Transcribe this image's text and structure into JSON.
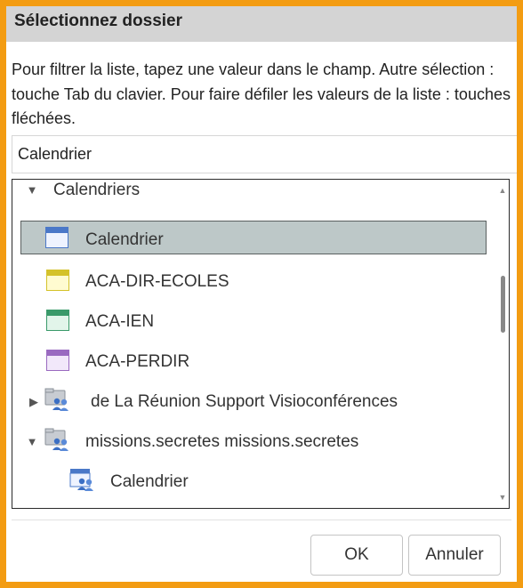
{
  "dialog": {
    "title": "Sélectionnez dossier",
    "instructions": "Pour filtrer la liste, tapez une valeur dans le champ. Autre sélection : touche Tab du clavier. Pour faire défiler les valeurs de la liste : touches fléchées."
  },
  "search": {
    "value": "Calendrier"
  },
  "tree": {
    "items": [
      {
        "label": "Calendriers",
        "icon": "expanded-arrow-icon",
        "expanded": true
      },
      {
        "label": "Calendrier",
        "icon": "calendar-blue-icon",
        "selected": true
      },
      {
        "label": "ACA-DIR-ECOLES",
        "icon": "calendar-yellow-icon"
      },
      {
        "label": "ACA-IEN",
        "icon": "calendar-green-icon"
      },
      {
        "label": "ACA-PERDIR",
        "icon": "calendar-purple-icon"
      },
      {
        "label": "de La Réunion Support Visioconférences",
        "icon": "shared-folder-icon",
        "expanded": false
      },
      {
        "label": "missions.secretes missions.secretes",
        "icon": "shared-folder-icon",
        "expanded": true
      },
      {
        "label": "Calendrier",
        "icon": "shared-calendar-icon"
      }
    ]
  },
  "buttons": {
    "ok": "OK",
    "cancel": "Annuler"
  },
  "colors": {
    "frame": "#f39c12",
    "titlebar": "#d4d4d4",
    "selected_row": "#bdc8c8"
  }
}
